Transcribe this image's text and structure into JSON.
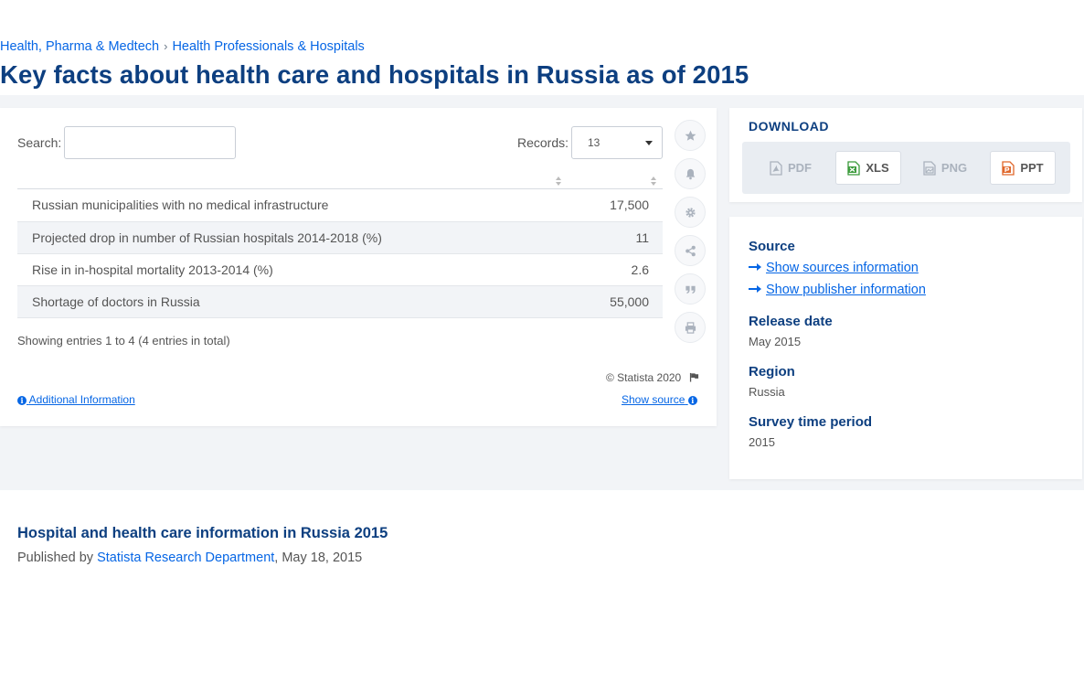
{
  "breadcrumb": {
    "item1": "Health, Pharma & Medtech",
    "separator": "›",
    "item2": "Health Professionals & Hospitals"
  },
  "page_title": "Key facts about health care and hospitals in Russia as of 2015",
  "table_controls": {
    "search_label": "Search:",
    "search_value": "",
    "records_label": "Records:",
    "records_value": "13"
  },
  "table": {
    "rows": [
      {
        "label": "Russian municipalities with no medical infrastructure",
        "value": "17,500"
      },
      {
        "label": "Projected drop in number of Russian hospitals 2014-2018 (%)",
        "value": "11"
      },
      {
        "label": "Rise in in-hospital mortality 2013-2014 (%)",
        "value": "2.6"
      },
      {
        "label": "Shortage of doctors in Russia",
        "value": "55,000"
      }
    ],
    "entries_text": "Showing entries 1 to 4 (4 entries in total)"
  },
  "footer": {
    "copyright": "© Statista 2020",
    "additional_info": "Additional Information",
    "show_source": "Show source"
  },
  "toolbar": {
    "icons": [
      "star-icon",
      "bell-icon",
      "gear-icon",
      "share-icon",
      "quote-icon",
      "print-icon"
    ]
  },
  "download": {
    "title": "DOWNLOAD",
    "buttons": [
      {
        "label": "PDF",
        "enabled": false
      },
      {
        "label": "XLS",
        "enabled": true
      },
      {
        "label": "PNG",
        "enabled": false
      },
      {
        "label": "PPT",
        "enabled": true
      }
    ]
  },
  "info": {
    "source_label": "Source",
    "show_sources": "Show sources information",
    "show_publisher": "Show publisher information",
    "release_date_label": "Release date",
    "release_date": "May 2015",
    "region_label": "Region",
    "region": "Russia",
    "survey_period_label": "Survey time period",
    "survey_period": "2015"
  },
  "report": {
    "title": "Hospital and health care information in Russia 2015",
    "published_by_prefix": "Published by",
    "publisher": "Statista Research Department",
    "date": ", May 18, 2015"
  },
  "colors": {
    "title_blue": "#0d3f80",
    "link_blue": "#0666e5",
    "xls_green": "#3a9a3a",
    "ppt_orange": "#e0672b",
    "background_gray": "#f2f4f7"
  }
}
